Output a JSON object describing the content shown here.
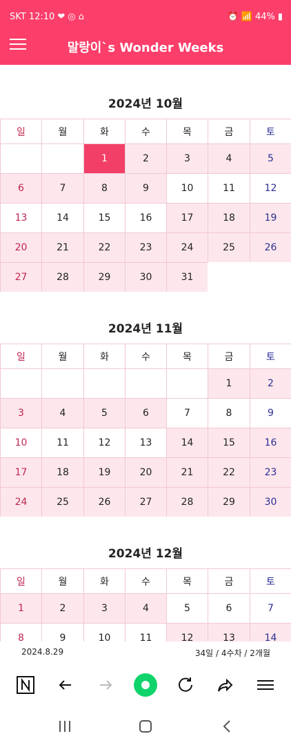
{
  "status_bar": {
    "carrier_time": "SKT 12:10",
    "battery": "44%"
  },
  "app": {
    "title": "말랑이`s Wonder Weeks"
  },
  "weekdays": [
    "일",
    "월",
    "화",
    "수",
    "목",
    "금",
    "토"
  ],
  "months": [
    {
      "title": "2024년 10월",
      "weeks": [
        [
          {
            "d": "",
            "bg": "white"
          },
          {
            "d": "",
            "bg": "white"
          },
          {
            "d": "1",
            "bg": "today"
          },
          {
            "d": "2",
            "bg": "pink"
          },
          {
            "d": "3",
            "bg": "pink"
          },
          {
            "d": "4",
            "bg": "pink"
          },
          {
            "d": "5",
            "bg": "pink"
          }
        ],
        [
          {
            "d": "6",
            "bg": "pink"
          },
          {
            "d": "7",
            "bg": "pink"
          },
          {
            "d": "8",
            "bg": "pink"
          },
          {
            "d": "9",
            "bg": "pink"
          },
          {
            "d": "10",
            "bg": "white"
          },
          {
            "d": "11",
            "bg": "white"
          },
          {
            "d": "12",
            "bg": "white"
          }
        ],
        [
          {
            "d": "13",
            "bg": "white"
          },
          {
            "d": "14",
            "bg": "white"
          },
          {
            "d": "15",
            "bg": "white"
          },
          {
            "d": "16",
            "bg": "white"
          },
          {
            "d": "17",
            "bg": "pink"
          },
          {
            "d": "18",
            "bg": "pink"
          },
          {
            "d": "19",
            "bg": "pink"
          }
        ],
        [
          {
            "d": "20",
            "bg": "pink"
          },
          {
            "d": "21",
            "bg": "pink"
          },
          {
            "d": "22",
            "bg": "pink"
          },
          {
            "d": "23",
            "bg": "pink"
          },
          {
            "d": "24",
            "bg": "pink"
          },
          {
            "d": "25",
            "bg": "pink"
          },
          {
            "d": "26",
            "bg": "pink"
          }
        ],
        [
          {
            "d": "27",
            "bg": "pink"
          },
          {
            "d": "28",
            "bg": "pink"
          },
          {
            "d": "29",
            "bg": "pink"
          },
          {
            "d": "30",
            "bg": "pink"
          },
          {
            "d": "31",
            "bg": "pink"
          }
        ]
      ]
    },
    {
      "title": "2024년 11월",
      "weeks": [
        [
          {
            "d": "",
            "bg": "white"
          },
          {
            "d": "",
            "bg": "white"
          },
          {
            "d": "",
            "bg": "white"
          },
          {
            "d": "",
            "bg": "white"
          },
          {
            "d": "",
            "bg": "white"
          },
          {
            "d": "1",
            "bg": "pink"
          },
          {
            "d": "2",
            "bg": "pink"
          }
        ],
        [
          {
            "d": "3",
            "bg": "pink"
          },
          {
            "d": "4",
            "bg": "pink"
          },
          {
            "d": "5",
            "bg": "pink"
          },
          {
            "d": "6",
            "bg": "pink"
          },
          {
            "d": "7",
            "bg": "white"
          },
          {
            "d": "8",
            "bg": "white"
          },
          {
            "d": "9",
            "bg": "white"
          }
        ],
        [
          {
            "d": "10",
            "bg": "white"
          },
          {
            "d": "11",
            "bg": "white"
          },
          {
            "d": "12",
            "bg": "white"
          },
          {
            "d": "13",
            "bg": "white"
          },
          {
            "d": "14",
            "bg": "pink"
          },
          {
            "d": "15",
            "bg": "pink"
          },
          {
            "d": "16",
            "bg": "pink"
          }
        ],
        [
          {
            "d": "17",
            "bg": "pink"
          },
          {
            "d": "18",
            "bg": "pink"
          },
          {
            "d": "19",
            "bg": "pink"
          },
          {
            "d": "20",
            "bg": "pink"
          },
          {
            "d": "21",
            "bg": "pink"
          },
          {
            "d": "22",
            "bg": "pink"
          },
          {
            "d": "23",
            "bg": "pink"
          }
        ],
        [
          {
            "d": "24",
            "bg": "pink"
          },
          {
            "d": "25",
            "bg": "pink"
          },
          {
            "d": "26",
            "bg": "pink"
          },
          {
            "d": "27",
            "bg": "pink"
          },
          {
            "d": "28",
            "bg": "pink"
          },
          {
            "d": "29",
            "bg": "pink"
          },
          {
            "d": "30",
            "bg": "pink"
          }
        ]
      ]
    },
    {
      "title": "2024년 12월",
      "weeks": [
        [
          {
            "d": "1",
            "bg": "pink"
          },
          {
            "d": "2",
            "bg": "pink"
          },
          {
            "d": "3",
            "bg": "pink"
          },
          {
            "d": "4",
            "bg": "pink"
          },
          {
            "d": "5",
            "bg": "white"
          },
          {
            "d": "6",
            "bg": "white"
          },
          {
            "d": "7",
            "bg": "white"
          }
        ],
        [
          {
            "d": "8",
            "bg": "white"
          },
          {
            "d": "9",
            "bg": "white"
          },
          {
            "d": "10",
            "bg": "white"
          },
          {
            "d": "11",
            "bg": "white"
          },
          {
            "d": "12",
            "bg": "pink"
          },
          {
            "d": "13",
            "bg": "pink"
          },
          {
            "d": "14",
            "bg": "pink"
          }
        ]
      ]
    }
  ],
  "footer": {
    "birth_date": "2024.8.29",
    "age_summary": "34일 / 4수차 / 2개월"
  },
  "icons": {
    "status_icons": [
      "heart-icon",
      "instagram-icon",
      "notification-icon",
      "alarm-icon",
      "wifi-icon",
      "signal-icon",
      "battery-icon"
    ],
    "browser_nav": [
      "n-logo-icon",
      "back-arrow-icon",
      "forward-arrow-icon",
      "home-circle-icon",
      "refresh-icon",
      "share-icon",
      "menu-icon"
    ],
    "system_nav": [
      "recent-apps-icon",
      "home-icon",
      "back-icon"
    ]
  },
  "colors": {
    "brand_pink": "#fc3e6a",
    "today_pink": "#f23f68",
    "pink_fill": "#fde7ec",
    "sunday": "#c1244e",
    "saturday": "#2a2d94",
    "green_button": "#10d46b"
  }
}
